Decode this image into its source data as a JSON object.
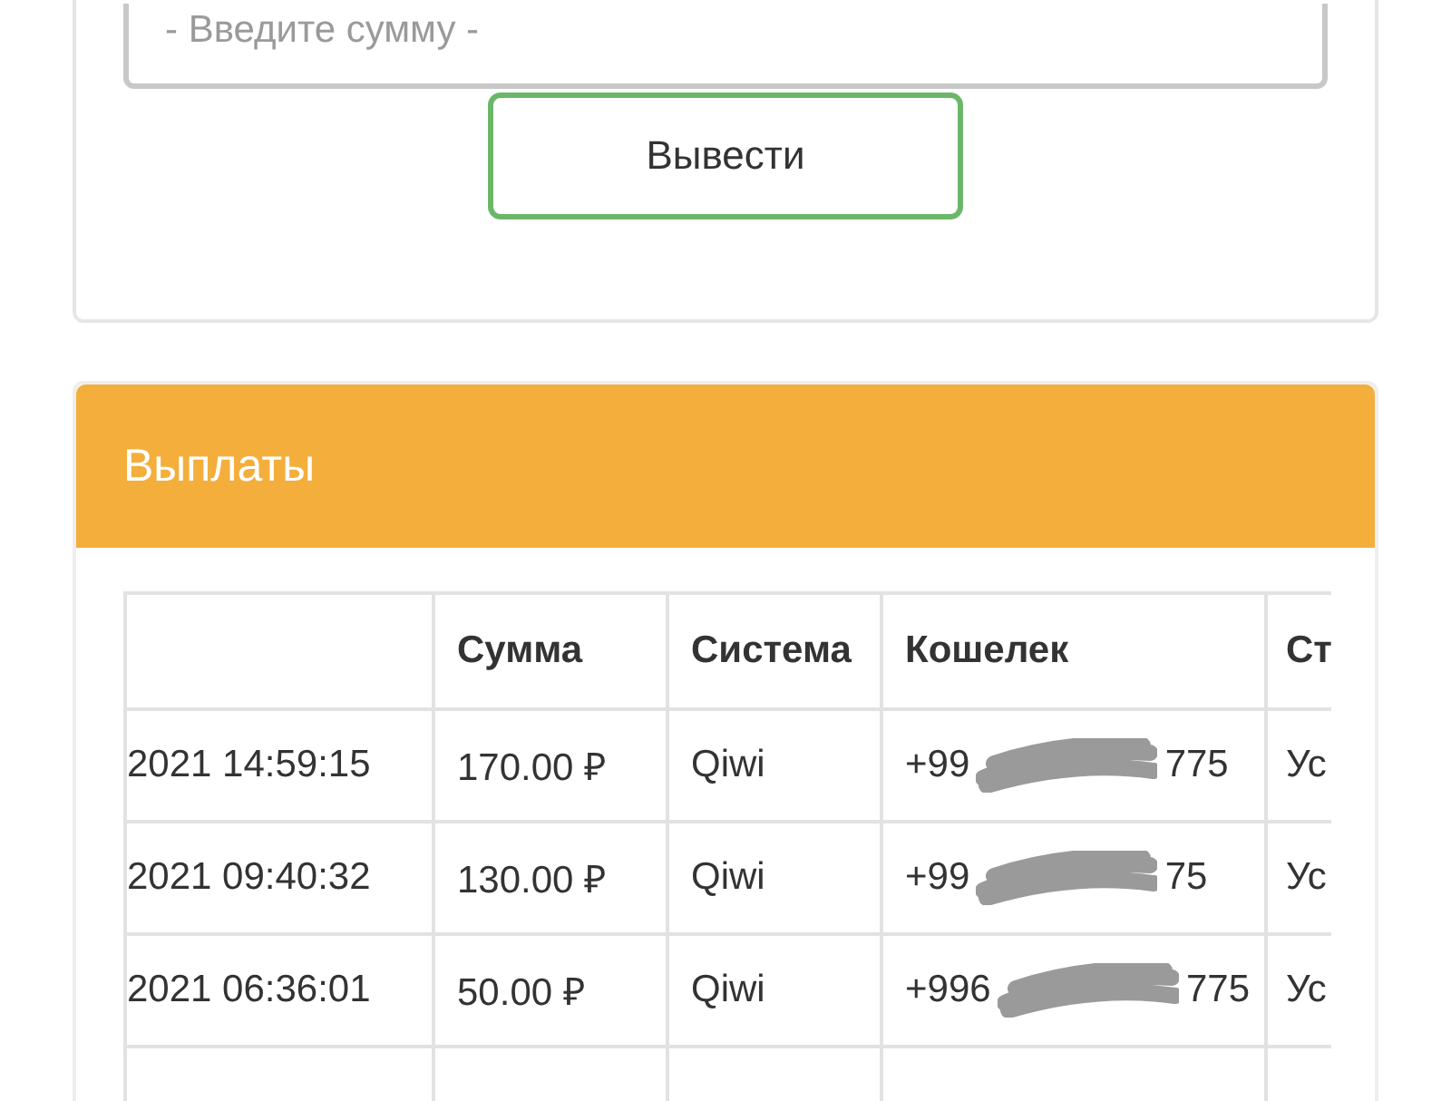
{
  "withdraw_form": {
    "amount_placeholder": "- Введите сумму -",
    "submit_button": "Вывести"
  },
  "payouts": {
    "title": "Выплаты",
    "table": {
      "columns": [
        "",
        "Сумма",
        "Система",
        "Кошелек",
        "Ст"
      ],
      "rows": [
        {
          "date": "2021 14:59:15",
          "amount": "170.00 ₽",
          "system": "Qiwi",
          "wallet_start": "+99",
          "wallet_end": "775",
          "status": "Ус"
        },
        {
          "date": "2021 09:40:32",
          "amount": "130.00 ₽",
          "system": "Qiwi",
          "wallet_start": "+99",
          "wallet_end": "75",
          "status": "Ус"
        },
        {
          "date": "2021 06:36:01",
          "amount": "50.00 ₽",
          "system": "Qiwi",
          "wallet_start": "+996",
          "wallet_end": "775",
          "status": "Ус"
        }
      ]
    }
  }
}
